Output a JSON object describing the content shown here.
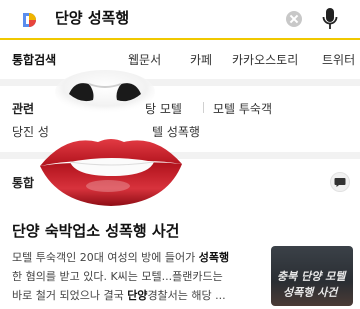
{
  "search": {
    "query": "단양 성폭행",
    "logo_icon": "daum-logo-icon",
    "clear_icon": "clear-icon",
    "mic_icon": "microphone-icon"
  },
  "tabs": [
    {
      "label": "통합검색",
      "active": true
    },
    {
      "label": "웹문서",
      "active": false
    },
    {
      "label": "카페",
      "active": false
    },
    {
      "label": "카카오스토리",
      "active": false
    },
    {
      "label": "트위터",
      "active": false
    }
  ],
  "related": {
    "title": "관련",
    "items": [
      "탕 모텔",
      "모텔 투숙객",
      "당진 성",
      "텔 성폭행"
    ]
  },
  "section": {
    "title": "통합",
    "comment_icon": "comment-icon"
  },
  "news": {
    "title": "단양 숙박업소 성폭행 사건",
    "line1_pre": "모텔 투숙객인 20대 여성의 방에 들어가 ",
    "line1_bold": "성폭행",
    "line2": "한 혐의를 받고 있다. K씨는 모텔...플랜카드는",
    "line3_pre": "바로 철거 되었으나 결국 ",
    "line3_bold": "단양",
    "line3_post": "경찰서는 해당 ...",
    "thumb_line1": "충북 단양 모텔",
    "thumb_line2": "성폭행 사건"
  },
  "colors": {
    "accent": "#f0c800",
    "lips": "#c81e28"
  }
}
